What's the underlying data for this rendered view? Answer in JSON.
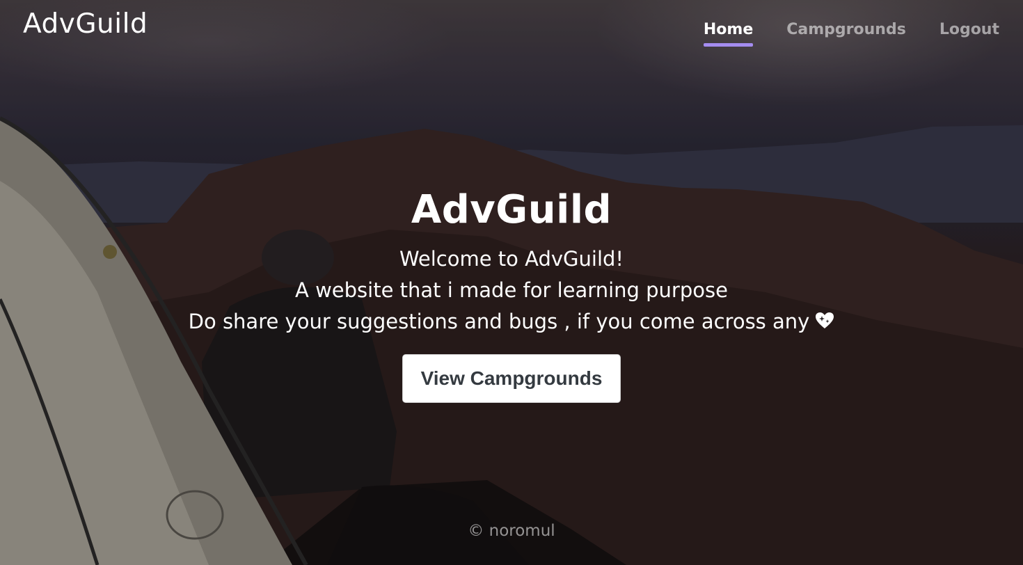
{
  "header": {
    "brand": "AdvGuild",
    "nav": [
      {
        "label": "Home",
        "active": true
      },
      {
        "label": "Campgrounds",
        "active": false
      },
      {
        "label": "Logout",
        "active": false
      }
    ]
  },
  "hero": {
    "title": "AdvGuild",
    "line1": "Welcome to AdvGuild!",
    "line2": "A website that i made for learning purpose",
    "line3": "Do share your suggestions and bugs , if you come across any",
    "heart_icon": "sparkling-heart-icon",
    "cta_label": "View Campgrounds"
  },
  "footer": {
    "copyright": "© noromul"
  },
  "colors": {
    "accent": "#a48cf0",
    "button_text": "#343a40"
  }
}
